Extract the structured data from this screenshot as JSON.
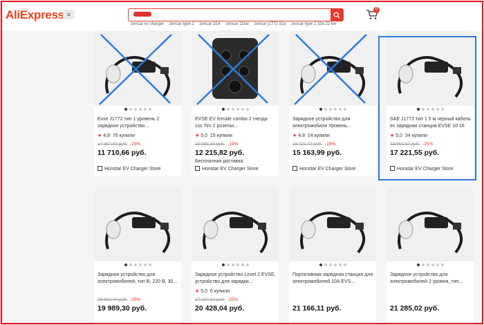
{
  "header": {
    "logo": "AliExpress",
    "menu_icon": "≡",
    "search": {
      "value": "",
      "placeholder": ""
    },
    "suggestions": [
      "zencar ev charger",
      "zencar type 2",
      "zencar 32A",
      "zencar 11kw",
      "zencar j1772 32a",
      "zencar type 2 32a 22 kw"
    ],
    "cart_count": "0"
  },
  "products": [
    {
      "title": "Evse J1772 тип 1 уровень 2 зарядное устройство...",
      "rating": "4,8",
      "sold": "76 купили",
      "old_price": "14 457,90 руб.",
      "discount": "-19%",
      "price": "11 710,66 руб.",
      "note": "",
      "store": "Honstar EV Charger Store"
    },
    {
      "title": "EVSE EV female combo 2 гнезда css Tim 2 розетки...",
      "rating": "5,0",
      "sold": "15 купили",
      "old_price": "15 081,16 руб.",
      "discount": "-19%",
      "price": "12 215,82 руб.",
      "note": "Бесплатная доставка",
      "store": "Honstar EV Charger Store"
    },
    {
      "title": "Зарядное устройство для электромобиля Уровень...",
      "rating": "4,8",
      "sold": "14 купили",
      "old_price": "18 721,47 руб.",
      "discount": "-19%",
      "price": "15 163,99 руб.",
      "note": "",
      "store": "Honstar EV Charger Store"
    },
    {
      "title": "SAE J1772 тип 1 5 м черный кабель ev зарядная станция EVSE 10 16 2...",
      "rating": "5,0",
      "sold": "34 купили",
      "old_price": "22 962,07 руб.",
      "discount": "-25%",
      "price": "17 221,55 руб.",
      "note": "",
      "store": "Honstar EV Charger Store"
    },
    {
      "title": "Зарядное устройство для электромобилей, тип B, 220 В, 30...",
      "rating": "",
      "sold": "",
      "old_price": "26 652,40 руб.",
      "discount": "-25%",
      "price": "19 989,30 руб.",
      "note": "",
      "store": ""
    },
    {
      "title": "Зарядное устройство Level 2 EVSE, устройство для зарядки...",
      "rating": "5,0",
      "sold": "6 купили",
      "old_price": "27 237,12 руб.",
      "discount": "-25%",
      "price": "20 428,04 руб.",
      "note": "",
      "store": ""
    },
    {
      "title": "Портативная зарядная станция для электромобилей 10А EVS...",
      "rating": "",
      "sold": "",
      "old_price": "",
      "discount": "",
      "price": "21 166,11 руб.",
      "note": "",
      "store": ""
    },
    {
      "title": "Зарядное устройство для электромобилей 2 уровня, тип...",
      "rating": "",
      "sold": "",
      "old_price": "",
      "discount": "",
      "price": "21 285,02 руб.",
      "note": "",
      "store": ""
    }
  ],
  "colors": {
    "brand": "#e8431c",
    "accent_red": "#e32b1f",
    "highlight_blue": "#2a7bd8",
    "frame_red": "#e0121b"
  },
  "icons": [
    "menu-icon",
    "search-icon",
    "cart-icon",
    "star-icon",
    "store-icon"
  ]
}
